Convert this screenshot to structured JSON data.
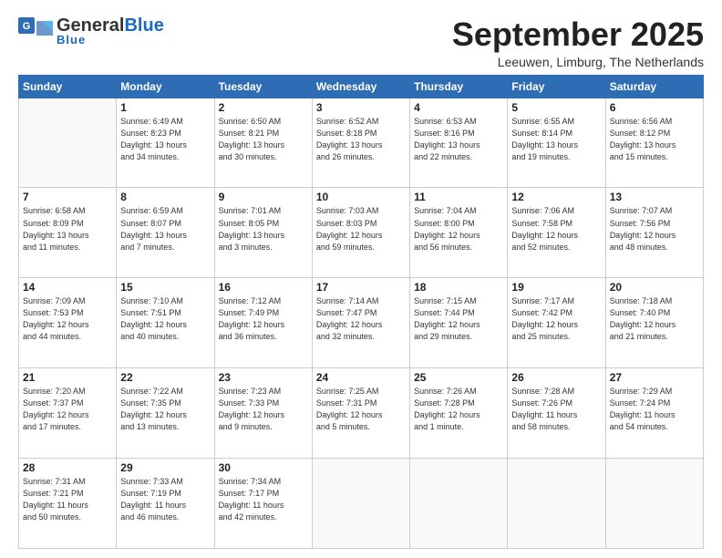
{
  "header": {
    "logo_general": "General",
    "logo_blue": "Blue",
    "month_title": "September 2025",
    "location": "Leeuwen, Limburg, The Netherlands"
  },
  "weekdays": [
    "Sunday",
    "Monday",
    "Tuesday",
    "Wednesday",
    "Thursday",
    "Friday",
    "Saturday"
  ],
  "weeks": [
    [
      {
        "day": "",
        "info": ""
      },
      {
        "day": "1",
        "info": "Sunrise: 6:49 AM\nSunset: 8:23 PM\nDaylight: 13 hours\nand 34 minutes."
      },
      {
        "day": "2",
        "info": "Sunrise: 6:50 AM\nSunset: 8:21 PM\nDaylight: 13 hours\nand 30 minutes."
      },
      {
        "day": "3",
        "info": "Sunrise: 6:52 AM\nSunset: 8:18 PM\nDaylight: 13 hours\nand 26 minutes."
      },
      {
        "day": "4",
        "info": "Sunrise: 6:53 AM\nSunset: 8:16 PM\nDaylight: 13 hours\nand 22 minutes."
      },
      {
        "day": "5",
        "info": "Sunrise: 6:55 AM\nSunset: 8:14 PM\nDaylight: 13 hours\nand 19 minutes."
      },
      {
        "day": "6",
        "info": "Sunrise: 6:56 AM\nSunset: 8:12 PM\nDaylight: 13 hours\nand 15 minutes."
      }
    ],
    [
      {
        "day": "7",
        "info": "Sunrise: 6:58 AM\nSunset: 8:09 PM\nDaylight: 13 hours\nand 11 minutes."
      },
      {
        "day": "8",
        "info": "Sunrise: 6:59 AM\nSunset: 8:07 PM\nDaylight: 13 hours\nand 7 minutes."
      },
      {
        "day": "9",
        "info": "Sunrise: 7:01 AM\nSunset: 8:05 PM\nDaylight: 13 hours\nand 3 minutes."
      },
      {
        "day": "10",
        "info": "Sunrise: 7:03 AM\nSunset: 8:03 PM\nDaylight: 12 hours\nand 59 minutes."
      },
      {
        "day": "11",
        "info": "Sunrise: 7:04 AM\nSunset: 8:00 PM\nDaylight: 12 hours\nand 56 minutes."
      },
      {
        "day": "12",
        "info": "Sunrise: 7:06 AM\nSunset: 7:58 PM\nDaylight: 12 hours\nand 52 minutes."
      },
      {
        "day": "13",
        "info": "Sunrise: 7:07 AM\nSunset: 7:56 PM\nDaylight: 12 hours\nand 48 minutes."
      }
    ],
    [
      {
        "day": "14",
        "info": "Sunrise: 7:09 AM\nSunset: 7:53 PM\nDaylight: 12 hours\nand 44 minutes."
      },
      {
        "day": "15",
        "info": "Sunrise: 7:10 AM\nSunset: 7:51 PM\nDaylight: 12 hours\nand 40 minutes."
      },
      {
        "day": "16",
        "info": "Sunrise: 7:12 AM\nSunset: 7:49 PM\nDaylight: 12 hours\nand 36 minutes."
      },
      {
        "day": "17",
        "info": "Sunrise: 7:14 AM\nSunset: 7:47 PM\nDaylight: 12 hours\nand 32 minutes."
      },
      {
        "day": "18",
        "info": "Sunrise: 7:15 AM\nSunset: 7:44 PM\nDaylight: 12 hours\nand 29 minutes."
      },
      {
        "day": "19",
        "info": "Sunrise: 7:17 AM\nSunset: 7:42 PM\nDaylight: 12 hours\nand 25 minutes."
      },
      {
        "day": "20",
        "info": "Sunrise: 7:18 AM\nSunset: 7:40 PM\nDaylight: 12 hours\nand 21 minutes."
      }
    ],
    [
      {
        "day": "21",
        "info": "Sunrise: 7:20 AM\nSunset: 7:37 PM\nDaylight: 12 hours\nand 17 minutes."
      },
      {
        "day": "22",
        "info": "Sunrise: 7:22 AM\nSunset: 7:35 PM\nDaylight: 12 hours\nand 13 minutes."
      },
      {
        "day": "23",
        "info": "Sunrise: 7:23 AM\nSunset: 7:33 PM\nDaylight: 12 hours\nand 9 minutes."
      },
      {
        "day": "24",
        "info": "Sunrise: 7:25 AM\nSunset: 7:31 PM\nDaylight: 12 hours\nand 5 minutes."
      },
      {
        "day": "25",
        "info": "Sunrise: 7:26 AM\nSunset: 7:28 PM\nDaylight: 12 hours\nand 1 minute."
      },
      {
        "day": "26",
        "info": "Sunrise: 7:28 AM\nSunset: 7:26 PM\nDaylight: 11 hours\nand 58 minutes."
      },
      {
        "day": "27",
        "info": "Sunrise: 7:29 AM\nSunset: 7:24 PM\nDaylight: 11 hours\nand 54 minutes."
      }
    ],
    [
      {
        "day": "28",
        "info": "Sunrise: 7:31 AM\nSunset: 7:21 PM\nDaylight: 11 hours\nand 50 minutes."
      },
      {
        "day": "29",
        "info": "Sunrise: 7:33 AM\nSunset: 7:19 PM\nDaylight: 11 hours\nand 46 minutes."
      },
      {
        "day": "30",
        "info": "Sunrise: 7:34 AM\nSunset: 7:17 PM\nDaylight: 11 hours\nand 42 minutes."
      },
      {
        "day": "",
        "info": ""
      },
      {
        "day": "",
        "info": ""
      },
      {
        "day": "",
        "info": ""
      },
      {
        "day": "",
        "info": ""
      }
    ]
  ]
}
